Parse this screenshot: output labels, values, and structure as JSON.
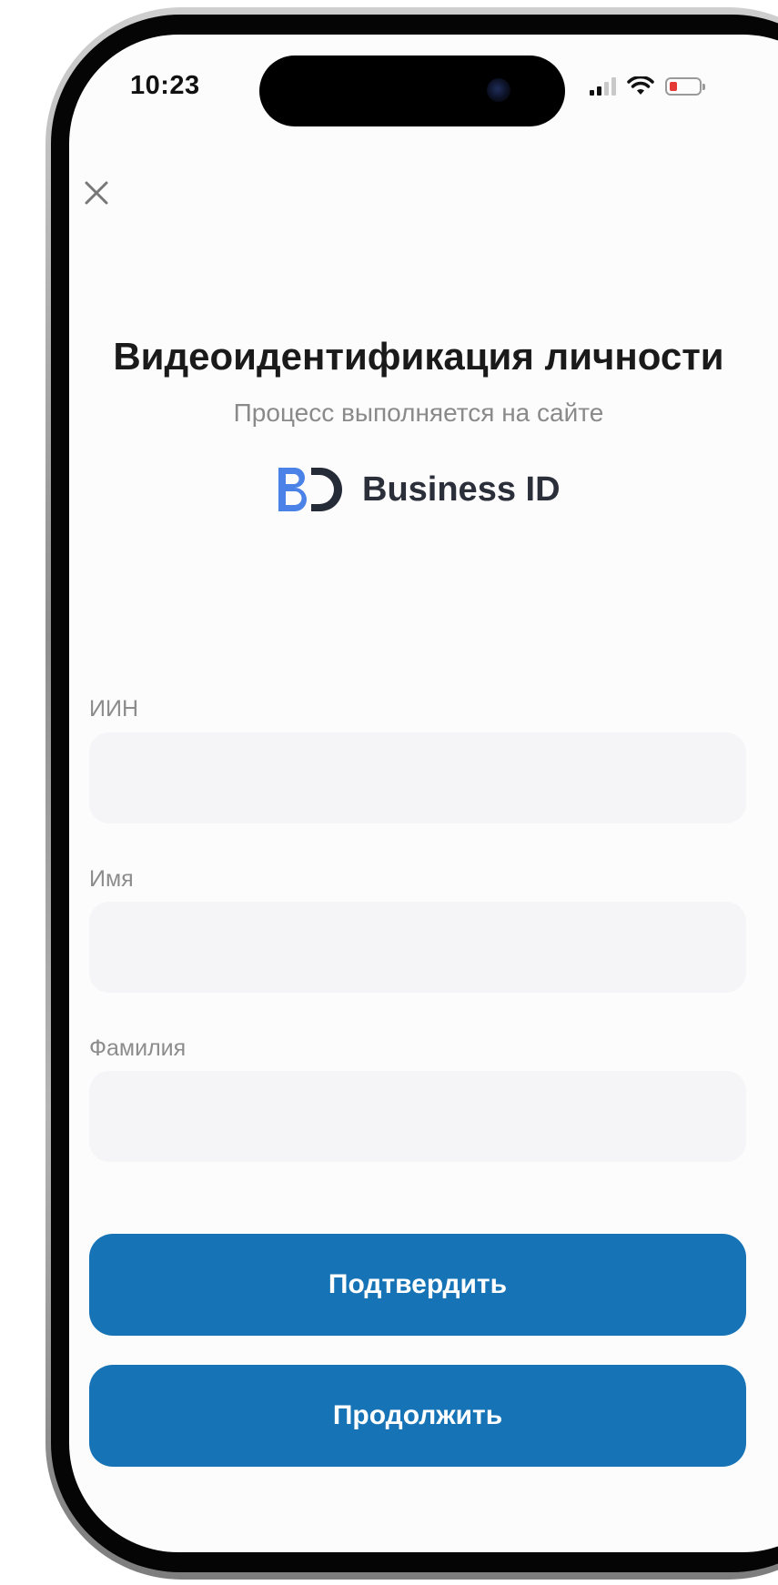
{
  "status_bar": {
    "time": "10:23",
    "icons": [
      "cellular-signal-icon",
      "wifi-icon",
      "battery-low-icon"
    ]
  },
  "header": {
    "close_icon": "close-icon"
  },
  "main": {
    "title": "Видеоидентификация личности",
    "subtitle": "Процесс выполняется на сайте",
    "logo": {
      "mark": "BD",
      "text": "Business ID",
      "colors": {
        "b": "#4a82e8",
        "d": "#262b38"
      }
    }
  },
  "form": {
    "fields": [
      {
        "label": "ИИН",
        "value": ""
      },
      {
        "label": "Имя",
        "value": ""
      },
      {
        "label": "Фамилия",
        "value": ""
      }
    ]
  },
  "actions": {
    "confirm_label": "Подтвердить",
    "continue_label": "Продолжить"
  },
  "colors": {
    "primary": "#1673b5",
    "input_bg": "#f5f5f7",
    "screen_bg": "#fdfcfd",
    "battery_low": "#e53935"
  }
}
